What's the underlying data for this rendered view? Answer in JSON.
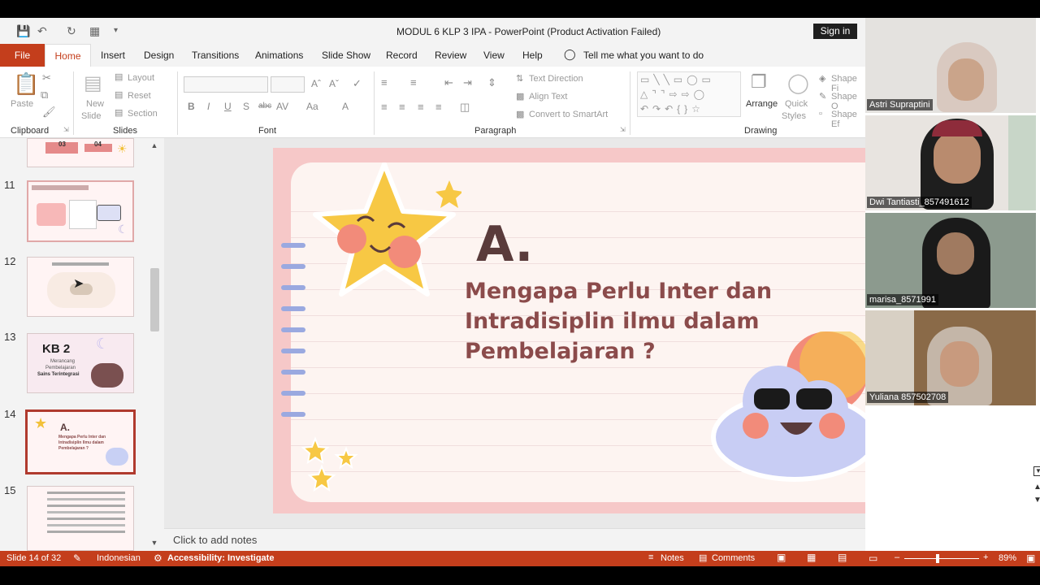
{
  "app": {
    "title": "MODUL 6 KLP 3 IPA  -  PowerPoint (Product Activation Failed)",
    "signin": "Sign in"
  },
  "tabs": [
    "File",
    "Home",
    "Insert",
    "Design",
    "Transitions",
    "Animations",
    "Slide Show",
    "Record",
    "Review",
    "View",
    "Help"
  ],
  "tell_me": "Tell me what you want to do",
  "ribbon": {
    "clipboard": {
      "label": "Clipboard",
      "paste": "Paste"
    },
    "slides": {
      "label": "Slides",
      "new_slide_1": "New",
      "new_slide_2": "Slide",
      "layout": "Layout",
      "reset": "Reset",
      "section": "Section"
    },
    "font": {
      "label": "Font"
    },
    "paragraph": {
      "label": "Paragraph",
      "text_direction": "Text Direction",
      "align_text": "Align Text",
      "convert_smartart": "Convert to SmartArt"
    },
    "drawing": {
      "label": "Drawing",
      "arrange": "Arrange",
      "quick_styles_1": "Quick",
      "quick_styles_2": "Styles",
      "shape_fill": "Shape Fi",
      "shape_outline": "Shape O",
      "shape_effects": "Shape Ef"
    }
  },
  "thumbnails": [
    {
      "num": "11"
    },
    {
      "num": "12"
    },
    {
      "num": "13",
      "kb": "KB 2",
      "line1": "Merancang",
      "line2": "Pembelajaran",
      "line3": "Sains Terintegrasi"
    },
    {
      "num": "14",
      "letter": "A.",
      "line1": "Mengapa Perlu Inter dan",
      "line2": "Intradisiplin Ilmu dalam",
      "line3": "Pembelajaran ?"
    },
    {
      "num": "15"
    }
  ],
  "thumb_top": {
    "a": "03",
    "b": "04"
  },
  "slide": {
    "letter": "A.",
    "question": "Mengapa Perlu Inter dan Intradisiplin ilmu dalam Pembelajaran ?"
  },
  "notes_placeholder": "Click to add notes",
  "status": {
    "slide": "Slide 14 of 32",
    "language": "Indonesian",
    "accessibility": "Accessibility: Investigate",
    "notes": "Notes",
    "comments": "Comments",
    "zoom": "89%"
  },
  "participants": [
    {
      "name": "Astri Supraptini"
    },
    {
      "name": "Dwi Tantiasti_857491612"
    },
    {
      "name": "marisa_8571991"
    },
    {
      "name": "Yuliana 857502708"
    }
  ],
  "colors": {
    "accent": "#c43e1c",
    "slide_bg": "#f6c8c8",
    "title_text": "#8b4b4b"
  }
}
